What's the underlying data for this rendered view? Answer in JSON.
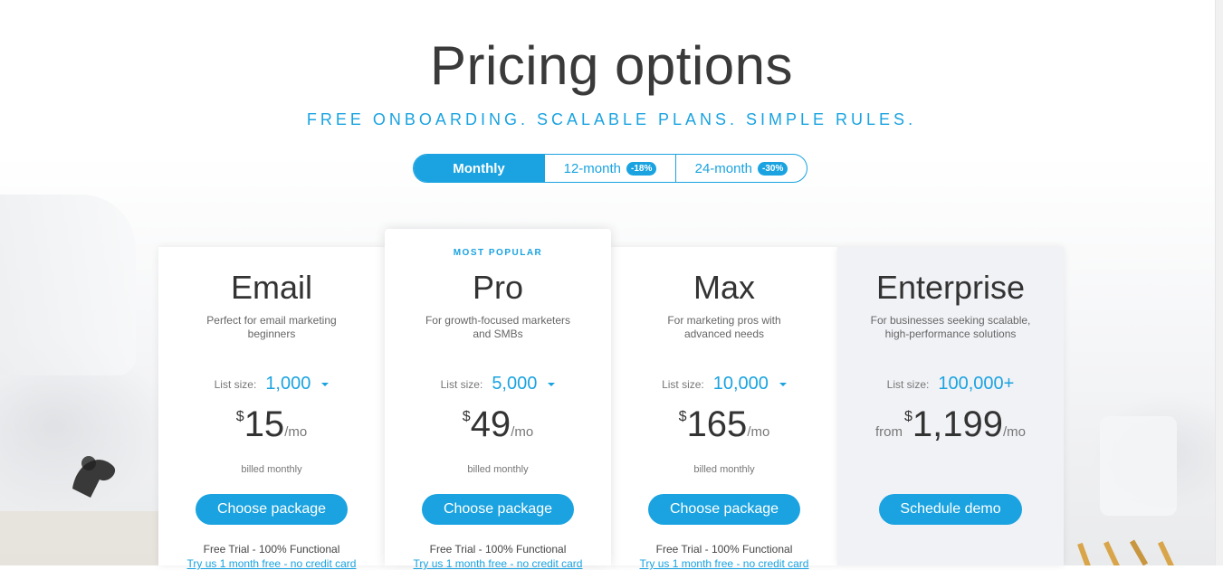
{
  "header": {
    "title": "Pricing options",
    "subtitle": "FREE ONBOARDING. SCALABLE PLANS. SIMPLE RULES."
  },
  "billing_toggle": {
    "options": [
      {
        "label": "Monthly",
        "badge": "",
        "active": true
      },
      {
        "label": "12-month",
        "badge": "-18%",
        "active": false
      },
      {
        "label": "24-month",
        "badge": "-30%",
        "active": false
      }
    ]
  },
  "plans": [
    {
      "name": "Email",
      "description": "Perfect for email marketing beginners",
      "list_size_label": "List size:",
      "list_size": "1,000",
      "currency": "$",
      "price": "15",
      "period": "/mo",
      "billed": "billed monthly",
      "button": "Choose package",
      "trial": "Free Trial - 100% Functional",
      "trial_link": "Try us 1 month free - no credit card"
    },
    {
      "badge": "MOST POPULAR",
      "name": "Pro",
      "description": "For growth-focused marketers and SMBs",
      "list_size_label": "List size:",
      "list_size": "5,000",
      "currency": "$",
      "price": "49",
      "period": "/mo",
      "billed": "billed monthly",
      "button": "Choose package",
      "trial": "Free Trial - 100% Functional",
      "trial_link": "Try us 1 month free - no credit card"
    },
    {
      "name": "Max",
      "description": "For marketing pros with advanced needs",
      "list_size_label": "List size:",
      "list_size": "10,000",
      "currency": "$",
      "price": "165",
      "period": "/mo",
      "billed": "billed monthly",
      "button": "Choose package",
      "trial": "Free Trial - 100% Functional",
      "trial_link": "Try us 1 month free - no credit card"
    },
    {
      "name": "Enterprise",
      "description": "For businesses seeking scalable, high-performance solutions",
      "list_size_label": "List size:",
      "list_size": "100,000+",
      "from": "from",
      "currency": "$",
      "price": "1,199",
      "period": "/mo",
      "button": "Schedule demo"
    }
  ],
  "colors": {
    "accent": "#1aa3e0",
    "text": "#333333",
    "enterprise_bg": "#f1f2f6"
  },
  "icons": {
    "dropdown": "caret-down-icon"
  }
}
